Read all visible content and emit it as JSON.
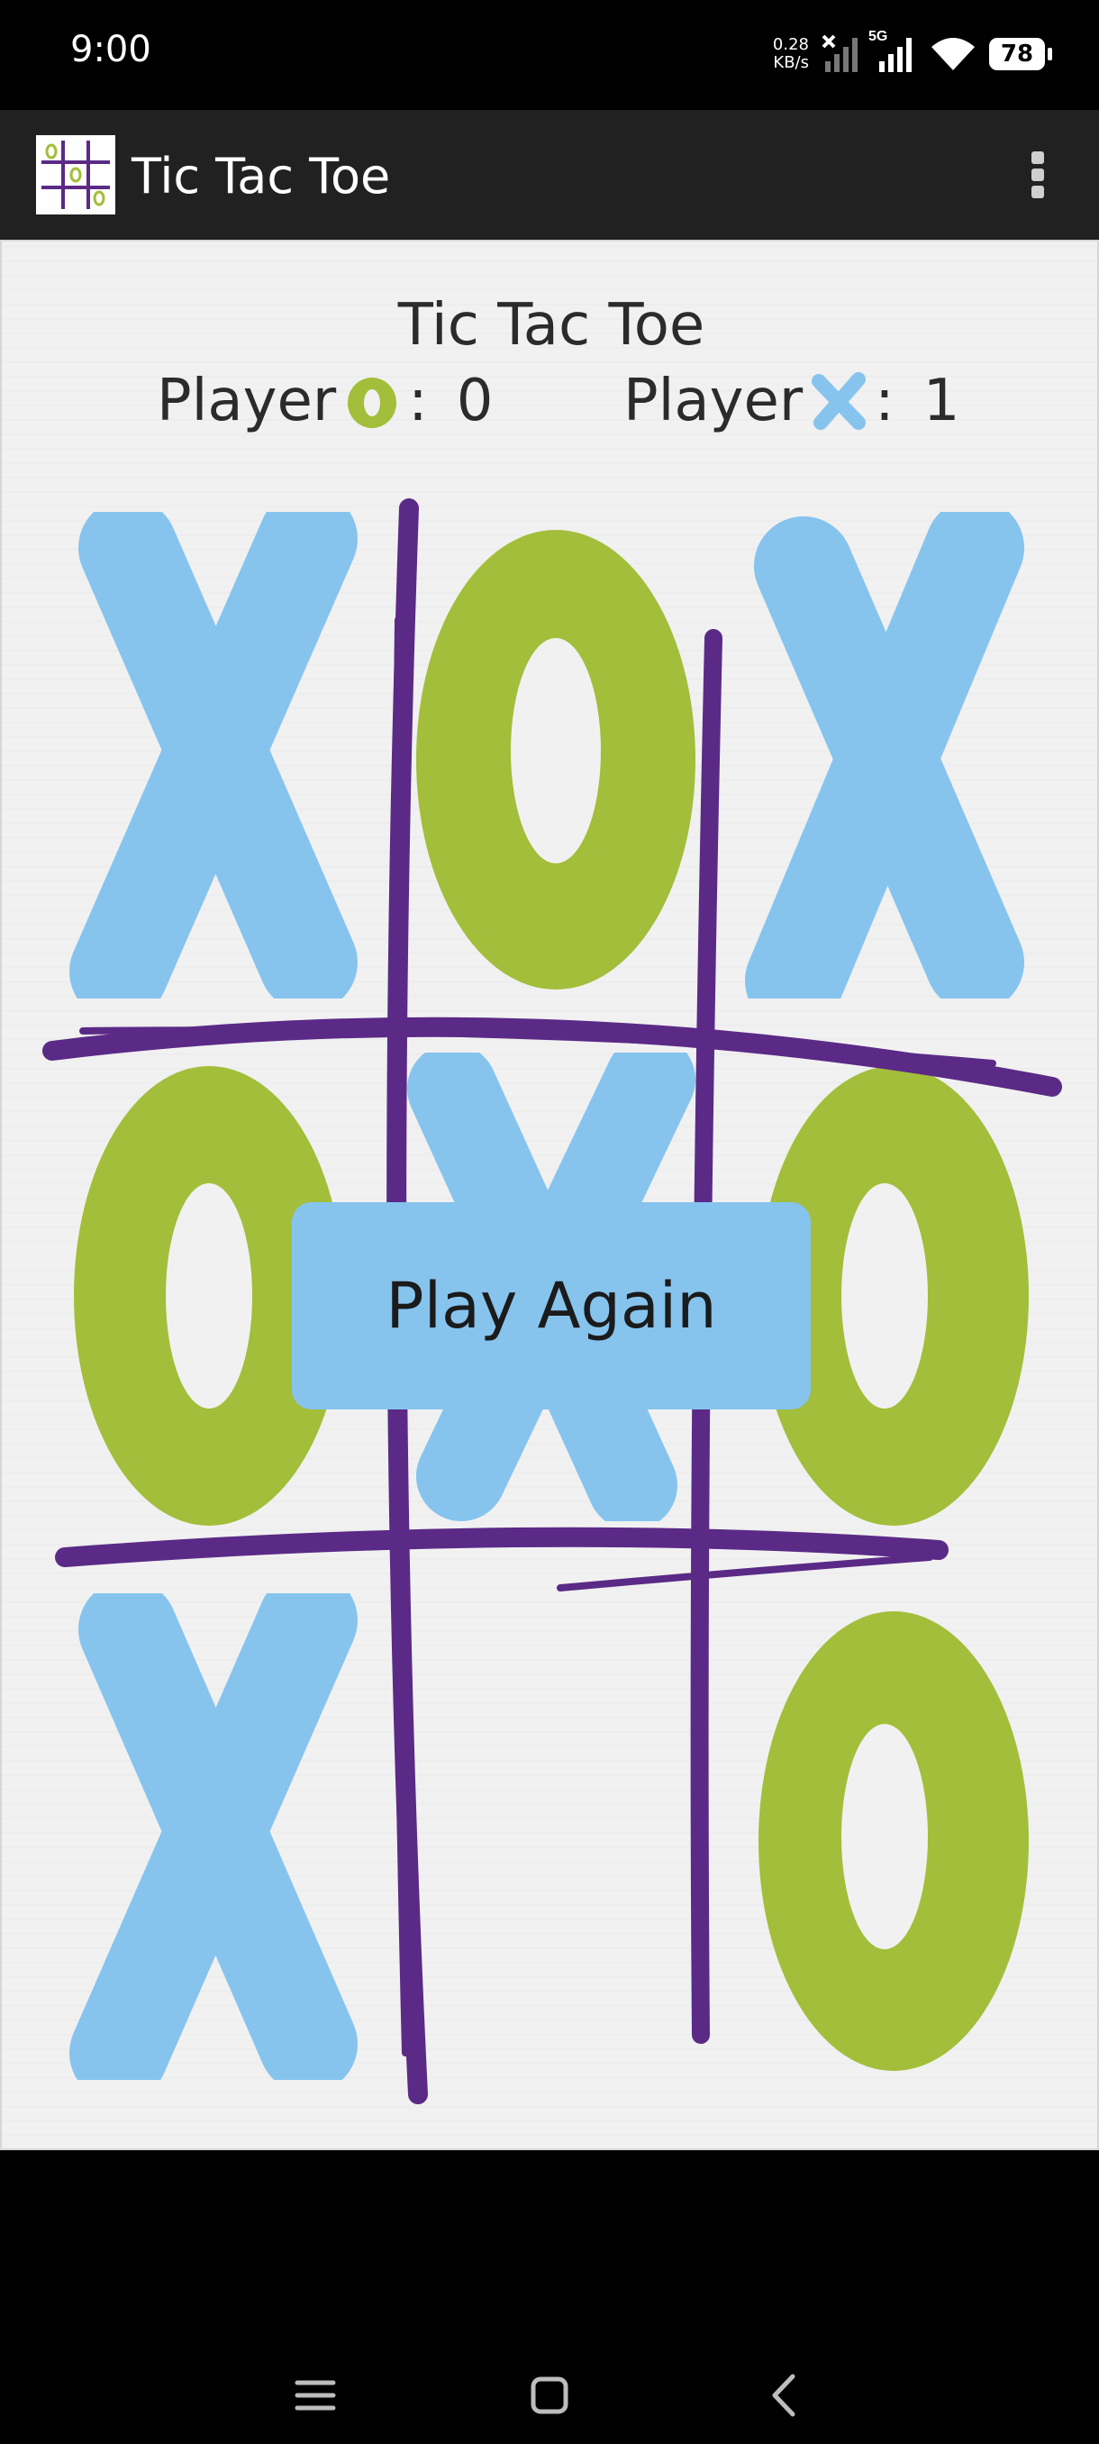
{
  "status_bar": {
    "time": "9:00",
    "net_speed_value": "0.28",
    "net_speed_unit": "KB/s",
    "network_label": "5G",
    "battery": "78"
  },
  "app_bar": {
    "title": "Tic Tac Toe"
  },
  "game": {
    "title": "Tic Tac Toe",
    "score_o": {
      "label": "Player",
      "separator": ":",
      "value": "0"
    },
    "score_x": {
      "label": "Player",
      "separator": ":",
      "value": "1"
    },
    "board": [
      "X",
      "O",
      "X",
      "O",
      "X",
      "O",
      "X",
      "",
      "O"
    ],
    "play_again_label": "Play Again"
  },
  "colors": {
    "x_color": "#86c4ee",
    "o_color": "#a3be3a",
    "grid_color": "#5b2a86",
    "button_color": "#86c4ee"
  }
}
